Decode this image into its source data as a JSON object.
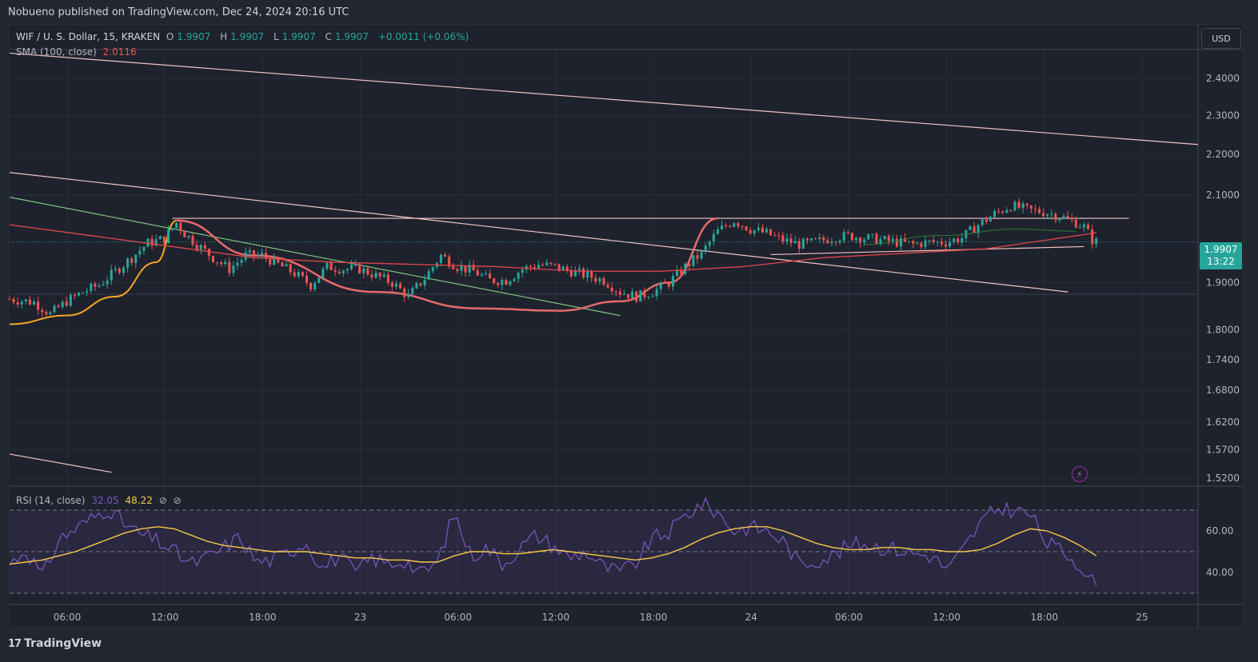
{
  "header": {
    "publisher_line": "Nobueno published on TradingView.com, Dec 24, 2024 20:16 UTC"
  },
  "legend": {
    "symbol": "WIF / U. S. Dollar, 15, KRAKEN",
    "o_label": "O",
    "o": "1.9907",
    "h_label": "H",
    "h": "1.9907",
    "l_label": "L",
    "l": "1.9907",
    "c_label": "C",
    "c": "1.9907",
    "change": "+0.0011 (+0.06%)",
    "sma_label": "SMA (100, close)",
    "sma_value": "2.0116",
    "rsi_label": "RSI (14, close)",
    "rsi_value": "32.05",
    "rsi_ma_value": "48.22",
    "null_icon_1": "⊘",
    "null_icon_2": "⊘"
  },
  "price_axis": {
    "currency": "USD",
    "last_price": "1.9907",
    "countdown": "13:22"
  },
  "footer": {
    "brand": "TradingView",
    "brand_mark": "17"
  },
  "icons": {
    "alert": "lightning-icon"
  },
  "colors": {
    "up": "#26a69a",
    "down": "#ef5350",
    "sma": "#e0474c",
    "trendline": "#f0c4c4",
    "green_trend": "#81c784",
    "orange_curve": "#f5a623",
    "rsi": "#7e57c2",
    "rsi_ma": "#f7c948"
  },
  "chart_data": [
    {
      "type": "candlestick",
      "title": "WIF / U. S. Dollar, 15, KRAKEN",
      "y_scale": "log",
      "ylim": [
        1.51,
        2.48
      ],
      "yticks": [
        2.4,
        2.3,
        2.2,
        2.1,
        1.9,
        1.8,
        1.74,
        1.68,
        1.62,
        1.57,
        1.52
      ],
      "ytick_labels": [
        "2.4000",
        "2.3000",
        "2.2000",
        "2.1000",
        "1.9000",
        "1.8000",
        "1.7400",
        "1.6800",
        "1.6200",
        "1.5700",
        "1.5200"
      ],
      "x_ticks": [
        "06:00",
        "12:00",
        "18:00",
        "23",
        "06:00",
        "12:00",
        "18:00",
        "24",
        "06:00",
        "12:00",
        "18:00",
        "25"
      ],
      "close_path": [
        [
          0,
          1.865
        ],
        [
          6,
          1.858
        ],
        [
          10,
          1.833
        ],
        [
          14,
          1.86
        ],
        [
          18,
          1.88
        ],
        [
          22,
          1.895
        ],
        [
          26,
          1.925
        ],
        [
          30,
          1.955
        ],
        [
          34,
          1.988
        ],
        [
          38,
          1.998
        ],
        [
          41,
          2.035
        ],
        [
          43,
          2.01
        ],
        [
          46,
          1.985
        ],
        [
          50,
          1.955
        ],
        [
          54,
          1.93
        ],
        [
          58,
          1.96
        ],
        [
          62,
          1.96
        ],
        [
          66,
          1.94
        ],
        [
          70,
          1.92
        ],
        [
          74,
          1.895
        ],
        [
          78,
          1.935
        ],
        [
          82,
          1.93
        ],
        [
          86,
          1.93
        ],
        [
          90,
          1.915
        ],
        [
          94,
          1.9
        ],
        [
          98,
          1.87
        ],
        [
          102,
          1.91
        ],
        [
          106,
          1.96
        ],
        [
          110,
          1.935
        ],
        [
          114,
          1.925
        ],
        [
          118,
          1.905
        ],
        [
          122,
          1.905
        ],
        [
          126,
          1.93
        ],
        [
          130,
          1.94
        ],
        [
          134,
          1.935
        ],
        [
          138,
          1.925
        ],
        [
          142,
          1.915
        ],
        [
          146,
          1.905
        ],
        [
          150,
          1.88
        ],
        [
          154,
          1.87
        ],
        [
          158,
          1.88
        ],
        [
          162,
          1.9
        ],
        [
          166,
          1.935
        ],
        [
          170,
          1.965
        ],
        [
          174,
          2.015
        ],
        [
          178,
          2.04
        ],
        [
          182,
          2.02
        ],
        [
          186,
          2.01
        ],
        [
          190,
          1.995
        ],
        [
          194,
          1.985
        ],
        [
          198,
          1.99
        ],
        [
          202,
          2.0
        ],
        [
          206,
          2.005
        ],
        [
          210,
          2.0
        ],
        [
          214,
          1.995
        ],
        [
          218,
          1.99
        ],
        [
          222,
          1.985
        ],
        [
          226,
          1.99
        ],
        [
          230,
          1.99
        ],
        [
          234,
          2.0
        ],
        [
          238,
          2.03
        ],
        [
          242,
          2.055
        ],
        [
          246,
          2.075
        ],
        [
          250,
          2.065
        ],
        [
          254,
          2.06
        ],
        [
          258,
          2.05
        ],
        [
          262,
          2.035
        ],
        [
          264,
          2.025
        ],
        [
          266,
          1.995
        ],
        [
          267,
          1.9907
        ]
      ],
      "sma_100_path": [
        [
          0,
          2.03
        ],
        [
          20,
          2.005
        ],
        [
          40,
          1.98
        ],
        [
          60,
          1.955
        ],
        [
          80,
          1.945
        ],
        [
          100,
          1.94
        ],
        [
          120,
          1.935
        ],
        [
          140,
          1.925
        ],
        [
          160,
          1.925
        ],
        [
          180,
          1.935
        ],
        [
          200,
          1.955
        ],
        [
          220,
          1.965
        ],
        [
          240,
          1.975
        ],
        [
          255,
          1.995
        ],
        [
          267,
          2.0116
        ]
      ],
      "trendlines": [
        {
          "from": [
            0,
            2.47
          ],
          "to": [
            292,
            2.225
          ]
        },
        {
          "from": [
            0,
            2.155
          ],
          "to": [
            260,
            1.88
          ]
        },
        {
          "from": [
            0,
            2.095
          ],
          "to": [
            150,
            1.83
          ]
        },
        {
          "from": [
            40,
            2.045
          ],
          "to": [
            275,
            2.045
          ]
        },
        {
          "from": [
            187,
            1.962
          ],
          "to": [
            264,
            1.98
          ]
        },
        {
          "from": [
            0,
            1.562
          ],
          "to": [
            25,
            1.53
          ]
        }
      ],
      "curves": [
        {
          "name": "",
          "points": [
            [
              0,
              1.812
            ],
            [
              14,
              1.83
            ],
            [
              26,
              1.87
            ],
            [
              36,
              1.945
            ],
            [
              41,
              2.04
            ]
          ]
        },
        {
          "name": "",
          "points": [
            [
              41,
              2.04
            ],
            [
              60,
              1.96
            ],
            [
              90,
              1.88
            ],
            [
              115,
              1.845
            ],
            [
              135,
              1.84
            ],
            [
              150,
              1.86
            ],
            [
              162,
              1.9
            ],
            [
              174,
              2.045
            ]
          ]
        }
      ]
    },
    {
      "type": "line",
      "title": "RSI (14, close)",
      "ylim": [
        25,
        80
      ],
      "yticks": [
        60,
        40
      ],
      "bands": [
        70,
        50,
        30
      ],
      "series": [
        {
          "name": "",
          "values": [
            44,
            51,
            38,
            56,
            61,
            66,
            71,
            63,
            58,
            55,
            50,
            44,
            47,
            52,
            57,
            45,
            46,
            50,
            55,
            42,
            48,
            40,
            47,
            44,
            46,
            39,
            45,
            69,
            48,
            52,
            44,
            52,
            58,
            53,
            47,
            50,
            43,
            40,
            44,
            56,
            59,
            67,
            73,
            69,
            60,
            62,
            60,
            55,
            44,
            46,
            48,
            53,
            54,
            52,
            51,
            49,
            48,
            41,
            52,
            64,
            71,
            70,
            68,
            54,
            50,
            44,
            33
          ]
        },
        {
          "name": "",
          "values": [
            44,
            45,
            46,
            48,
            50,
            53,
            56,
            59,
            61,
            62,
            61,
            58,
            55,
            53,
            52,
            51,
            50,
            50,
            50,
            49,
            48,
            47,
            47,
            46,
            46,
            45,
            45,
            48,
            50,
            50,
            49,
            49,
            50,
            51,
            50,
            49,
            48,
            47,
            46,
            47,
            49,
            52,
            56,
            59,
            61,
            62,
            62,
            60,
            57,
            54,
            52,
            51,
            51,
            52,
            52,
            51,
            51,
            50,
            50,
            51,
            54,
            58,
            61,
            60,
            57,
            53,
            48
          ]
        }
      ]
    }
  ]
}
